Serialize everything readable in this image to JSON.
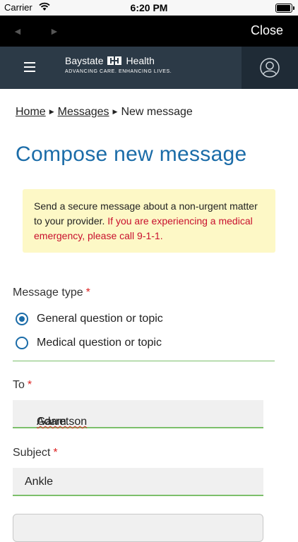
{
  "status_bar": {
    "carrier": "Carrier",
    "time": "6:20 PM",
    "battery_level": 0.95
  },
  "browser": {
    "back_icon": "◄",
    "forward_icon": "►",
    "close_label": "Close"
  },
  "header": {
    "brand_left": "Baystate",
    "brand_right": "Health",
    "tagline": "ADVANCING CARE. ENHANCING LIVES."
  },
  "breadcrumb": {
    "home": "Home",
    "messages": "Messages",
    "current": "New message"
  },
  "page_title": "Compose new message",
  "notice": {
    "text": "Send a secure message about a non-urgent matter to your provider.",
    "warning": "If you are experiencing a medical emergency, please call 9-1-1."
  },
  "message_type": {
    "label": "Message type",
    "required": "*",
    "options": [
      {
        "label": "General question or topic",
        "selected": true
      },
      {
        "label": "Medical question or topic",
        "selected": false
      }
    ]
  },
  "to": {
    "label": "To",
    "required": "*",
    "value": "Adam Garretson",
    "first": "Adam",
    "last": "Garretson"
  },
  "subject": {
    "label": "Subject",
    "required": "*",
    "value": "Ankle"
  },
  "colors": {
    "accent": "#1b6ca8",
    "header_bg": "#2c3a47",
    "valid_border": "#7cbf6a",
    "alert_bg": "#fdf8c6",
    "warning": "#c8102e"
  }
}
